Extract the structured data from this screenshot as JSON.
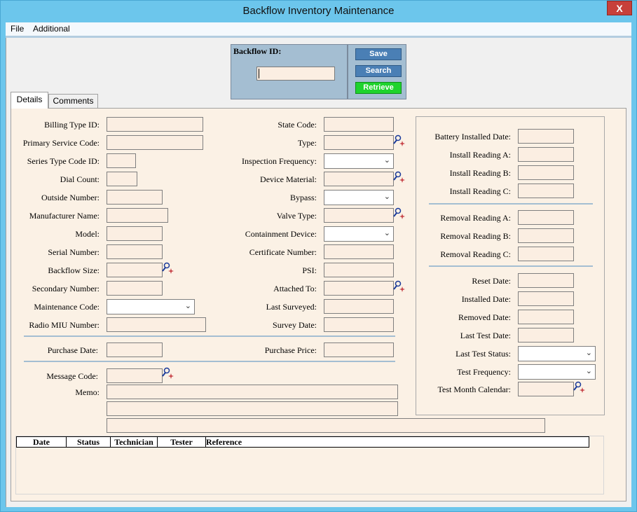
{
  "window": {
    "title": "Backflow Inventory Maintenance",
    "close_label": "X"
  },
  "menu": {
    "file": "File",
    "additional": "Additional"
  },
  "id_panel": {
    "label": "Backflow ID:",
    "value": ""
  },
  "actions": {
    "save": "Save",
    "search": "Search",
    "retrieve": "Retrieve"
  },
  "tabs": {
    "details": "Details",
    "comments": "Comments"
  },
  "left": {
    "billing_type_id": "Billing Type ID:",
    "primary_service_code": "Primary Service Code:",
    "series_type_code_id": "Series Type Code ID:",
    "dial_count": "Dial Count:",
    "outside_number": "Outside Number:",
    "manufacturer_name": "Manufacturer Name:",
    "model": "Model:",
    "serial_number": "Serial Number:",
    "backflow_size": "Backflow Size:",
    "secondary_number": "Secondary Number:",
    "maintenance_code": "Maintenance Code:",
    "radio_miu_number": "Radio MIU Number:",
    "purchase_date": "Purchase Date:",
    "message_code": "Message Code:",
    "memo": "Memo:"
  },
  "middle": {
    "state_code": "State Code:",
    "type": "Type:",
    "inspection_frequency": "Inspection Frequency:",
    "device_material": "Device Material:",
    "bypass": "Bypass:",
    "valve_type": "Valve Type:",
    "containment_device": "Containment Device:",
    "certificate_number": "Certificate Number:",
    "psi": "PSI:",
    "attached_to": "Attached To:",
    "last_surveyed": "Last Surveyed:",
    "survey_date": "Survey Date:",
    "purchase_price": "Purchase Price:"
  },
  "right": {
    "battery_installed_date": "Battery Installed Date:",
    "install_reading_a": "Install Reading A:",
    "install_reading_b": "Install Reading B:",
    "install_reading_c": "Install Reading C:",
    "removal_reading_a": "Removal Reading A:",
    "removal_reading_b": "Removal Reading B:",
    "removal_reading_c": "Removal Reading C:",
    "reset_date": "Reset Date:",
    "installed_date": "Installed Date:",
    "removed_date": "Removed Date:",
    "last_test_date": "Last Test Date:",
    "last_test_status": "Last Test Status:",
    "test_frequency": "Test Frequency:",
    "test_month_calendar": "Test Month Calendar:"
  },
  "grid": {
    "columns": [
      "Date",
      "Status",
      "Technician",
      "Tester",
      "Reference"
    ]
  },
  "icons": {
    "lookup": "search-lookup-icon",
    "dropdown": "chevron-down-icon"
  },
  "colors": {
    "title_bar": "#6cc6ec",
    "panel": "#a4bed2",
    "form_bg": "#fbf1e5",
    "retrieve": "#1ed32d",
    "close": "#c7403a"
  }
}
